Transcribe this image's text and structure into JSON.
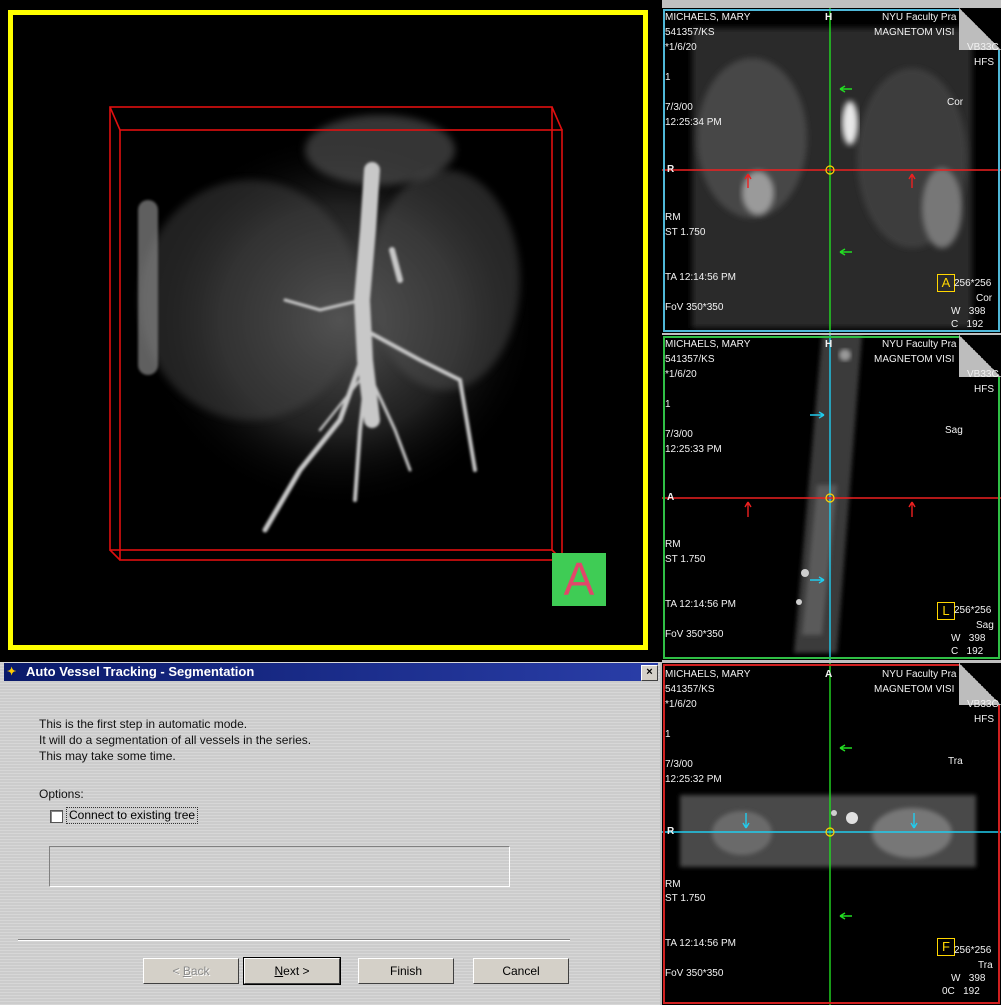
{
  "colors": {
    "viewport_border": "#ffff00",
    "bounding_box": "#e01010",
    "pane_coronal_border": "#4fb8d8",
    "pane_sagittal_border": "#2fbf45",
    "pane_transverse_border": "#d02020",
    "crosshair_green": "#22dd22",
    "crosshair_red": "#ee2020",
    "crosshair_cyan": "#20ccee",
    "marker_yellow": "#ffd600",
    "title_bar": "#0b1f6e"
  },
  "viewport": {
    "orientation_letter": "A"
  },
  "dialog": {
    "title": "Auto Vessel Tracking - Segmentation",
    "title_icon": "app-icon",
    "close_label": "×",
    "description_lines": [
      "This is the first step in automatic mode.",
      "It will do a segmentation of all vessels in the series.",
      "This may take some time."
    ],
    "options_label": "Options:",
    "connect_label": "Connect to existing tree",
    "connect_checked": false,
    "buttons": {
      "back": "< Back",
      "next": "Next >",
      "finish": "Finish",
      "cancel": "Cancel"
    }
  },
  "panes": [
    {
      "id": "coronal",
      "patient_name": "MICHAELS, MARY",
      "patient_id": "541357/KS",
      "dob": "*1/6/20",
      "institution": "NYU Faculty Pra",
      "scanner": "MAGNETOM VISI",
      "sequence": "VB33C",
      "position": "HFS",
      "image_no": "1",
      "date": "7/3/00",
      "time": "12:25:34 PM",
      "plane": "Cor",
      "orient_top": "H",
      "orient_left": "R",
      "rm": "RM",
      "slice_thickness": "ST 1.750",
      "ta": "TA 12:14:56 PM",
      "fov": "FoV 350*350",
      "badge": "A",
      "matrix": "256*256",
      "plane_bottom": "Cor",
      "window_w": "W   398",
      "window_c": "C   192"
    },
    {
      "id": "sagittal",
      "patient_name": "MICHAELS, MARY",
      "patient_id": "541357/KS",
      "dob": "*1/6/20",
      "institution": "NYU Faculty Pra",
      "scanner": "MAGNETOM VISI",
      "sequence": "VB33C",
      "position": "HFS",
      "image_no": "1",
      "date": "7/3/00",
      "time": "12:25:33 PM",
      "plane": "Sag",
      "orient_top": "H",
      "orient_left": "A",
      "rm": "RM",
      "slice_thickness": "ST 1.750",
      "ta": "TA 12:14:56 PM",
      "fov": "FoV 350*350",
      "badge": "L",
      "matrix": "256*256",
      "plane_bottom": "Sag",
      "window_w": "W   398",
      "window_c": "C   192"
    },
    {
      "id": "transverse",
      "patient_name": "MICHAELS, MARY",
      "patient_id": "541357/KS",
      "dob": "*1/6/20",
      "institution": "NYU Faculty Pra",
      "scanner": "MAGNETOM VISI",
      "sequence": "VB33C",
      "position": "HFS",
      "image_no": "1",
      "date": "7/3/00",
      "time": "12:25:32 PM",
      "plane": "Tra",
      "orient_top": "A",
      "orient_left": "R",
      "rm": "RM",
      "slice_thickness": "ST 1.750",
      "ta": "TA 12:14:56 PM",
      "fov": "FoV 350*350",
      "badge": "F",
      "matrix": "256*256",
      "plane_bottom": "Tra",
      "window_w": "W   398",
      "window_c": "0C   192"
    }
  ]
}
